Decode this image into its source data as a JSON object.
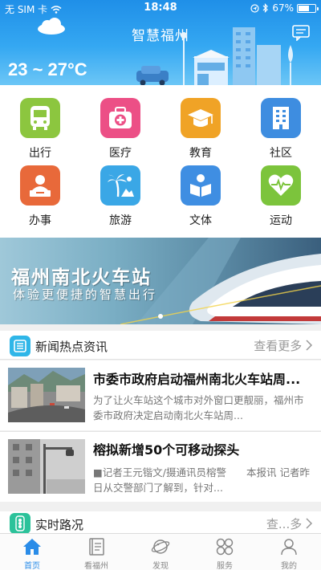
{
  "status": {
    "carrier": "无 SIM 卡",
    "time": "18:48",
    "battery": "67%",
    "battery_fraction": 0.67
  },
  "header": {
    "title": "智慧福州",
    "temperature": "23 ~ 27°C"
  },
  "services": [
    {
      "label": "出行",
      "icon": "bus-icon",
      "color": "#8cc63f"
    },
    {
      "label": "医疗",
      "icon": "medical-kit-icon",
      "color": "#ec4f86"
    },
    {
      "label": "教育",
      "icon": "graduation-cap-icon",
      "color": "#f0a326"
    },
    {
      "label": "社区",
      "icon": "building-icon",
      "color": "#3e8de0"
    },
    {
      "label": "办事",
      "icon": "clerk-icon",
      "color": "#e8693a"
    },
    {
      "label": "旅游",
      "icon": "palm-tree-icon",
      "color": "#3aa7e6"
    },
    {
      "label": "文体",
      "icon": "reader-icon",
      "color": "#3f8ee2"
    },
    {
      "label": "运动",
      "icon": "heart-pulse-icon",
      "color": "#7cc43c"
    }
  ],
  "banner": {
    "title": "福州南北火车站",
    "subtitle": "体验更便捷的智慧出行"
  },
  "news": {
    "title": "新闻热点资讯",
    "more": "查看更多",
    "items": [
      {
        "title": "市委市政府启动福州南北火车站周...",
        "summary": "为了让火车站这个城市对外窗口更靓丽，福州市委市政府决定启动南北火车站周..."
      },
      {
        "title": "榕拟新增50个可移动探头",
        "summary": "■记者王元锴文/摄通讯员榕警　　本报讯 记者昨日从交警部门了解到，针对..."
      }
    ]
  },
  "traffic": {
    "title": "实时路况",
    "more": "查...多"
  },
  "tabs": [
    {
      "label": "首页",
      "icon": "home-icon",
      "active": true
    },
    {
      "label": "看福州",
      "icon": "book-icon",
      "active": false
    },
    {
      "label": "发现",
      "icon": "planet-icon",
      "active": false
    },
    {
      "label": "服务",
      "icon": "grid-icon",
      "active": false
    },
    {
      "label": "我的",
      "icon": "user-icon",
      "active": false
    }
  ]
}
